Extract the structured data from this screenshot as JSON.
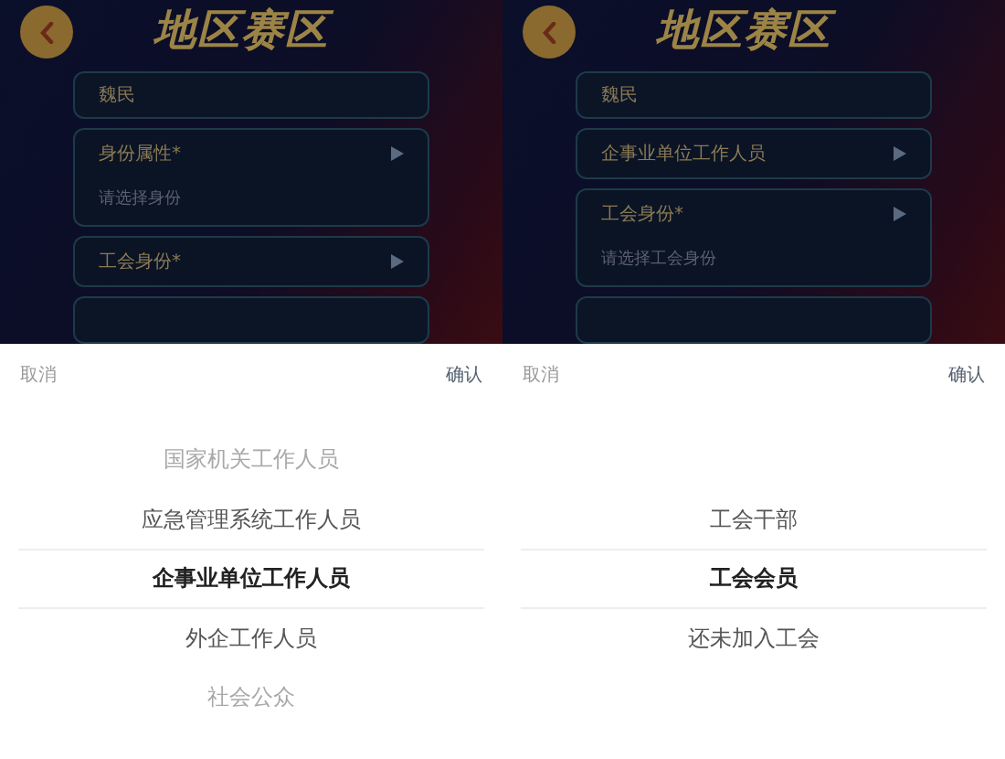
{
  "screens": [
    {
      "title": "地区赛区",
      "fields": [
        {
          "kind": "text",
          "value": "魏民"
        },
        {
          "kind": "select",
          "label": "身份属性*",
          "placeholder": "请选择身份"
        },
        {
          "kind": "select",
          "label": "工会身份*"
        }
      ],
      "picker": {
        "cancel": "取消",
        "confirm": "确认",
        "options": [
          {
            "label": "国家机关工作人员",
            "selected": false
          },
          {
            "label": "应急管理系统工作人员",
            "selected": false
          },
          {
            "label": "企事业单位工作人员",
            "selected": true
          },
          {
            "label": "外企工作人员",
            "selected": false
          },
          {
            "label": "社会公众",
            "selected": false
          }
        ]
      }
    },
    {
      "title": "地区赛区",
      "fields": [
        {
          "kind": "text",
          "value": "魏民"
        },
        {
          "kind": "select",
          "label": "企事业单位工作人员"
        },
        {
          "kind": "select",
          "label": "工会身份*",
          "placeholder": "请选择工会身份"
        }
      ],
      "picker": {
        "cancel": "取消",
        "confirm": "确认",
        "options": [
          {
            "label": "工会干部",
            "selected": false
          },
          {
            "label": "工会会员",
            "selected": true
          },
          {
            "label": "还未加入工会",
            "selected": false
          }
        ]
      }
    }
  ]
}
